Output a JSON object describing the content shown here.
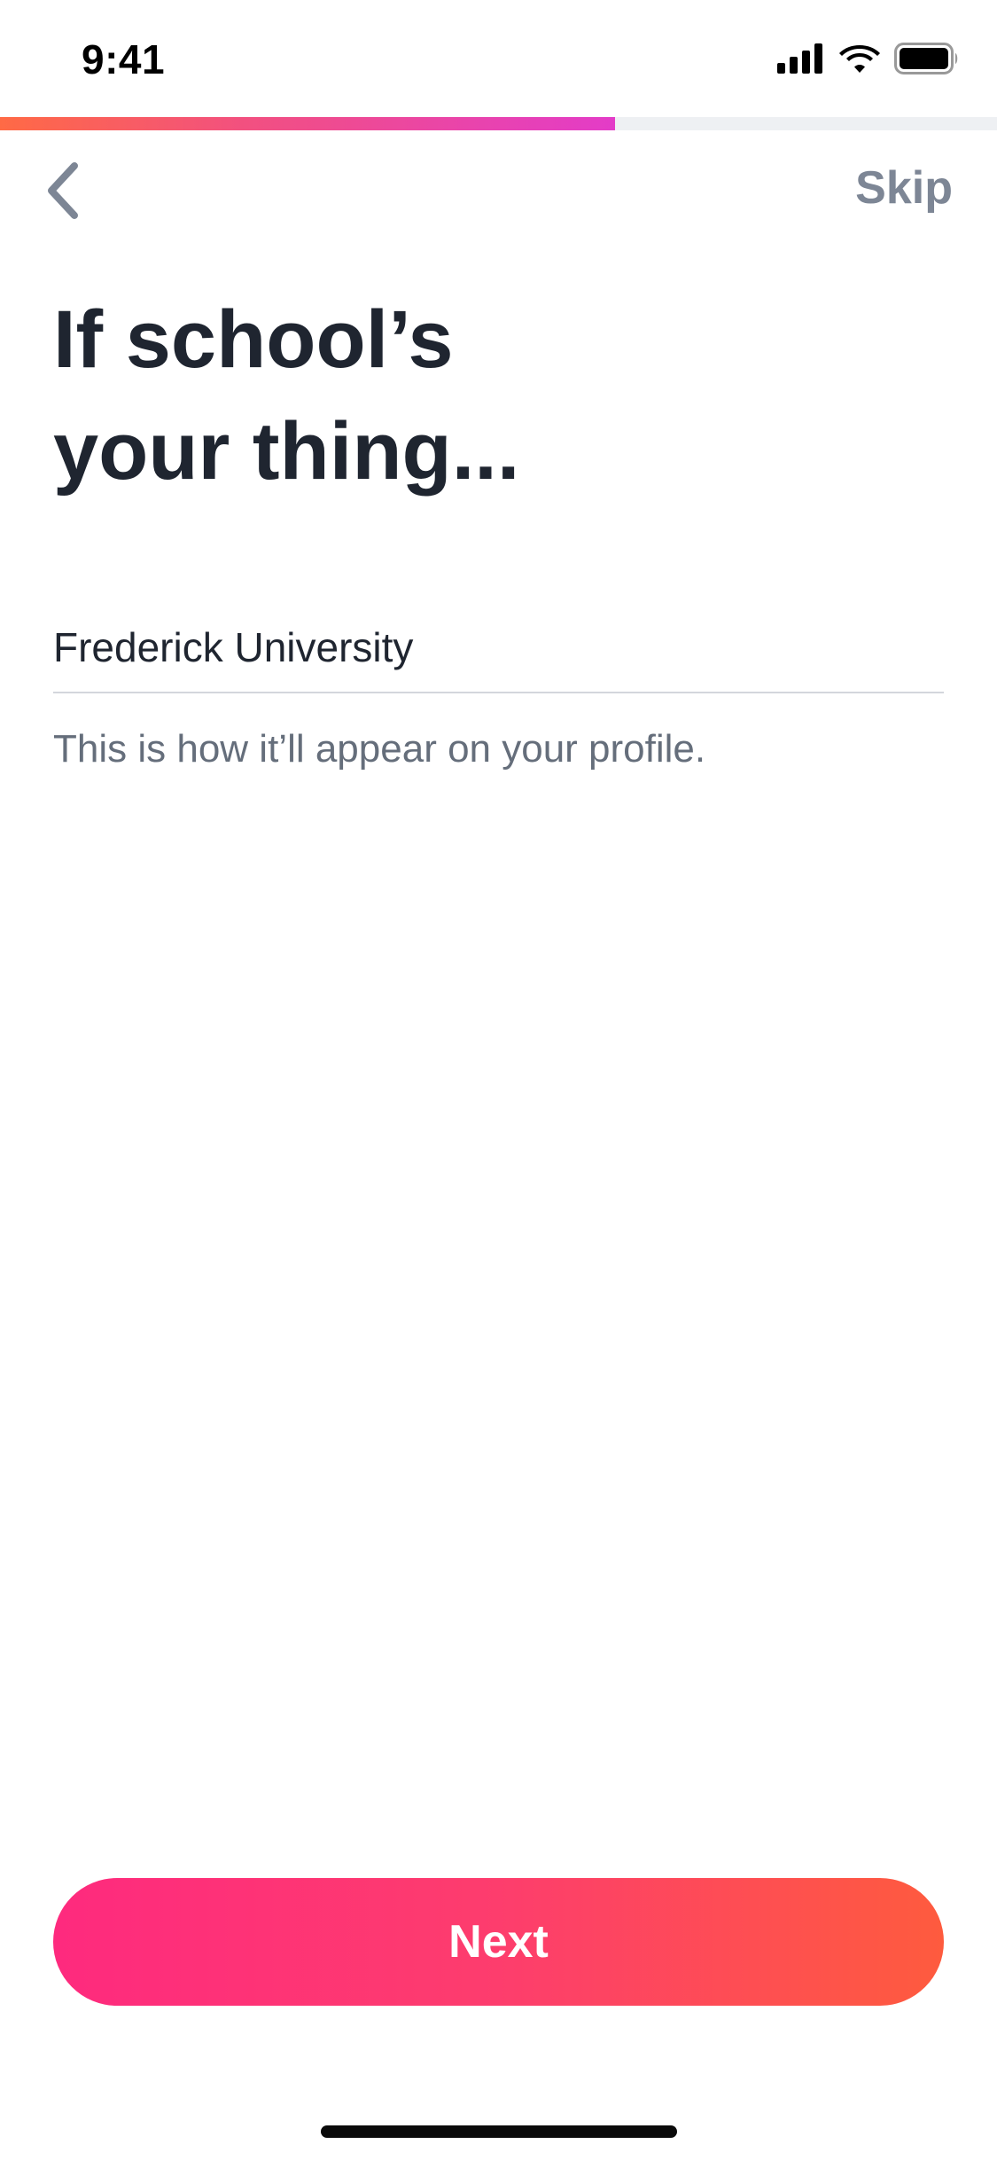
{
  "status_bar": {
    "time": "9:41",
    "icons": [
      "cellular-signal-icon",
      "wifi-icon",
      "battery-icon"
    ]
  },
  "progress": {
    "fraction": 0.617
  },
  "nav": {
    "back_icon": "chevron-left-icon",
    "skip_label": "Skip"
  },
  "title": {
    "line1": "If school’s",
    "line2": "your thing..."
  },
  "school_input": {
    "value": "Frederick University"
  },
  "helper_text": "This is how it’ll appear on your profile.",
  "next_button": {
    "label": "Next"
  },
  "colors": {
    "accent_start": "#fe2a7e",
    "accent_end": "#fe5b3e",
    "progress_end": "#e33cc8",
    "text_primary": "#1f2530",
    "text_secondary": "#656e7b",
    "skip_gray": "#7d8695"
  }
}
